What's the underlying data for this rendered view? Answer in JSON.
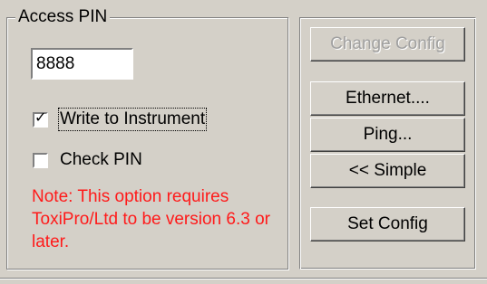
{
  "access_pin": {
    "group_title": "Access PIN",
    "pin_value": "8888"
  },
  "options": {
    "write_to_instrument": {
      "label": "Write to Instrument",
      "checked": true
    },
    "check_pin": {
      "label": "Check PIN",
      "checked": false
    }
  },
  "note": {
    "text": "Note: This option requires ToxiPro/Ltd to be version 6.3 or later.",
    "color": "#ff1a1a"
  },
  "buttons": {
    "change_config": {
      "label": "Change Config",
      "enabled": false
    },
    "ethernet": {
      "label": "Ethernet...."
    },
    "ping": {
      "label": "Ping..."
    },
    "simple": {
      "label": "<< Simple"
    },
    "set_config": {
      "label": "Set Config"
    }
  },
  "colors": {
    "background": "#d4d0c8",
    "note_text": "#ff1a1a",
    "disabled_text": "#a0a0a0"
  }
}
